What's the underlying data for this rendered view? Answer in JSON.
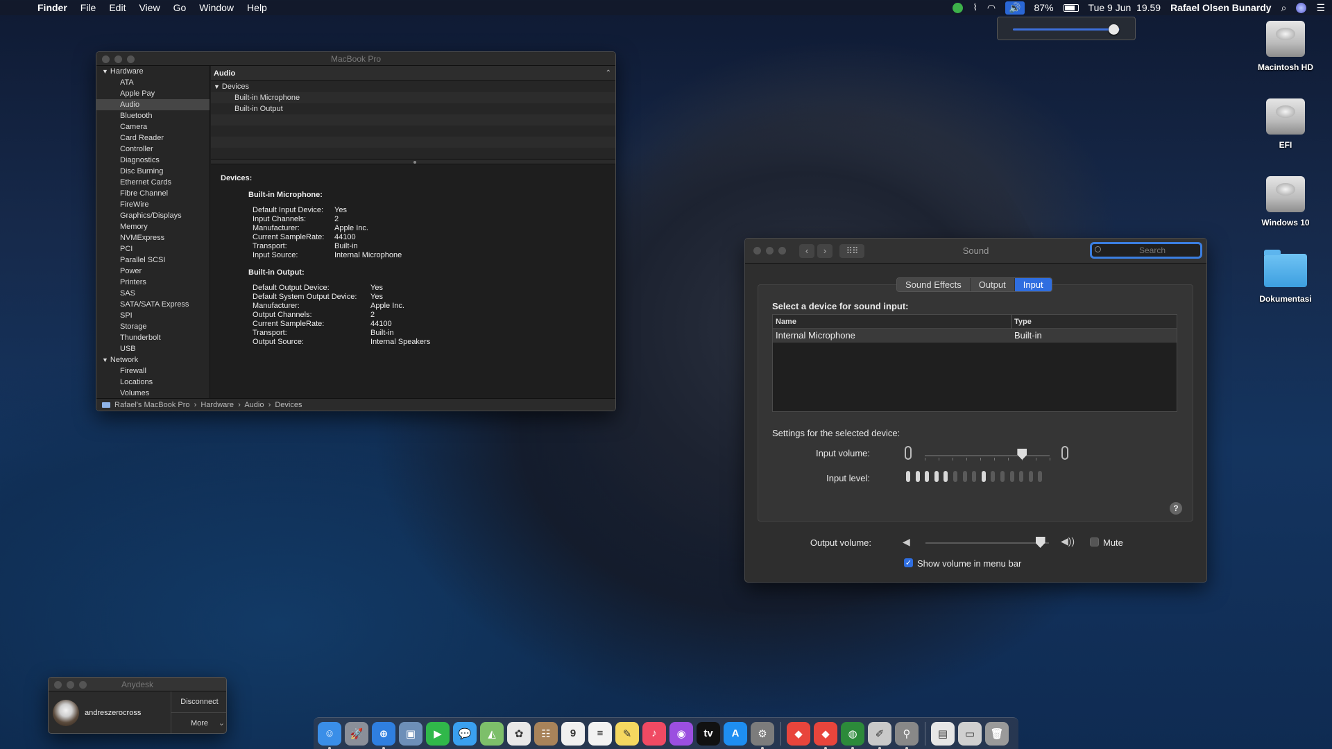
{
  "menubar": {
    "app_name": "Finder",
    "menus": [
      "File",
      "Edit",
      "View",
      "Go",
      "Window",
      "Help"
    ],
    "battery": "87%",
    "battery_level": 0.87,
    "datetime": "Tue 9 Jun  19.59",
    "user": "Rafael Olsen Bunardy"
  },
  "volume_popup": {
    "level": 0.93
  },
  "desktop_icons": [
    {
      "label": "Macintosh HD",
      "kind": "disk"
    },
    {
      "label": "EFI",
      "kind": "disk"
    },
    {
      "label": "Windows 10",
      "kind": "disk"
    },
    {
      "label": "Dokumentasi",
      "kind": "folder"
    }
  ],
  "sysinfo": {
    "title": "MacBook Pro",
    "sidebar": [
      {
        "label": "Hardware",
        "group": true
      },
      {
        "label": "ATA"
      },
      {
        "label": "Apple Pay"
      },
      {
        "label": "Audio",
        "selected": true
      },
      {
        "label": "Bluetooth"
      },
      {
        "label": "Camera"
      },
      {
        "label": "Card Reader"
      },
      {
        "label": "Controller"
      },
      {
        "label": "Diagnostics"
      },
      {
        "label": "Disc Burning"
      },
      {
        "label": "Ethernet Cards"
      },
      {
        "label": "Fibre Channel"
      },
      {
        "label": "FireWire"
      },
      {
        "label": "Graphics/Displays"
      },
      {
        "label": "Memory"
      },
      {
        "label": "NVMExpress"
      },
      {
        "label": "PCI"
      },
      {
        "label": "Parallel SCSI"
      },
      {
        "label": "Power"
      },
      {
        "label": "Printers"
      },
      {
        "label": "SAS"
      },
      {
        "label": "SATA/SATA Express"
      },
      {
        "label": "SPI"
      },
      {
        "label": "Storage"
      },
      {
        "label": "Thunderbolt"
      },
      {
        "label": "USB"
      },
      {
        "label": "Network",
        "group": true
      },
      {
        "label": "Firewall"
      },
      {
        "label": "Locations"
      },
      {
        "label": "Volumes"
      }
    ],
    "list_header": "Audio",
    "tree": {
      "group": "Devices",
      "items": [
        "Built-in Microphone",
        "Built-in Output"
      ]
    },
    "details": {
      "heading": "Devices:",
      "mic_heading": "Built-in Microphone:",
      "mic": [
        [
          "Default Input Device:",
          "Yes"
        ],
        [
          "Input Channels:",
          "2"
        ],
        [
          "Manufacturer:",
          "Apple Inc."
        ],
        [
          "Current SampleRate:",
          "44100"
        ],
        [
          "Transport:",
          "Built-in"
        ],
        [
          "Input Source:",
          "Internal Microphone"
        ]
      ],
      "out_heading": "Built-in Output:",
      "out": [
        [
          "Default Output Device:",
          "Yes"
        ],
        [
          "Default System Output Device:",
          "Yes"
        ],
        [
          "Manufacturer:",
          "Apple Inc."
        ],
        [
          "Output Channels:",
          "2"
        ],
        [
          "Current SampleRate:",
          "44100"
        ],
        [
          "Transport:",
          "Built-in"
        ],
        [
          "Output Source:",
          "Internal Speakers"
        ]
      ]
    },
    "breadcrumb": "Rafael's MacBook Pro  ›  Hardware  ›  Audio  ›  Devices"
  },
  "sound": {
    "title": "Sound",
    "search_placeholder": "Search",
    "tabs": [
      "Sound Effects",
      "Output",
      "Input"
    ],
    "active_tab": "Input",
    "select_label": "Select a device for sound input:",
    "col_name": "Name",
    "col_type": "Type",
    "device_name": "Internal Microphone",
    "device_type": "Built-in",
    "settings_label": "Settings for the selected device:",
    "input_volume_label": "Input volume:",
    "input_volume": 0.78,
    "input_level_label": "Input level:",
    "input_level_bars": 15,
    "input_level_on": [
      0,
      1,
      2,
      3,
      4,
      8
    ],
    "output_volume_label": "Output volume:",
    "output_volume": 0.93,
    "mute_label": "Mute",
    "show_volume_label": "Show volume in menu bar",
    "help": "?"
  },
  "anydesk": {
    "title": "Anydesk",
    "user": "andreszerocross",
    "disconnect": "Disconnect",
    "more": "More"
  },
  "dock": [
    {
      "name": "finder-icon",
      "color": "#3a8ee8",
      "glyph": "☺"
    },
    {
      "name": "launchpad-icon",
      "color": "#8a8f99",
      "glyph": "🚀"
    },
    {
      "name": "safari-icon",
      "color": "#2f7fe0",
      "glyph": "⊕"
    },
    {
      "name": "preview-icon",
      "color": "#6d8fb8",
      "glyph": "▣"
    },
    {
      "name": "facetime-icon",
      "color": "#30b84a",
      "glyph": "▶"
    },
    {
      "name": "messages-icon",
      "color": "#3aa0f0",
      "glyph": "💬"
    },
    {
      "name": "maps-icon",
      "color": "#7dbf6a",
      "glyph": "◭"
    },
    {
      "name": "photos-icon",
      "color": "#e8e8e8",
      "glyph": "✿"
    },
    {
      "name": "contacts-icon",
      "color": "#a8835a",
      "glyph": "☷"
    },
    {
      "name": "calendar-icon",
      "color": "#f0f0f0",
      "glyph": "9"
    },
    {
      "name": "reminders-icon",
      "color": "#f2f2f2",
      "glyph": "≡"
    },
    {
      "name": "notes-icon",
      "color": "#f5d860",
      "glyph": "✎"
    },
    {
      "name": "music-icon",
      "color": "#f04a63",
      "glyph": "♪"
    },
    {
      "name": "podcasts-icon",
      "color": "#9b4fe0",
      "glyph": "◉"
    },
    {
      "name": "tv-icon",
      "color": "#111111",
      "glyph": "tv"
    },
    {
      "name": "app-store-icon",
      "color": "#1e8ef2",
      "glyph": "A"
    },
    {
      "name": "system-preferences-icon",
      "color": "#7c7c7c",
      "glyph": "⚙"
    },
    {
      "name": "anydesk-icon",
      "color": "#e8453c",
      "glyph": "◆"
    },
    {
      "name": "anydesk-alt-icon",
      "color": "#e8453c",
      "glyph": "◆"
    },
    {
      "name": "globe-icon",
      "color": "#2c8a3a",
      "glyph": "◍"
    },
    {
      "name": "script-editor-icon",
      "color": "#c9c9c9",
      "glyph": "✐"
    },
    {
      "name": "automator-icon",
      "color": "#888888",
      "glyph": "⚲"
    },
    {
      "name": "documents-icon",
      "color": "#e6e6e6",
      "glyph": "▤"
    },
    {
      "name": "screenshot-icon",
      "color": "#d0d0d0",
      "glyph": "▭"
    },
    {
      "name": "trash-icon",
      "color": "#9a9a9a",
      "glyph": "🗑"
    }
  ]
}
